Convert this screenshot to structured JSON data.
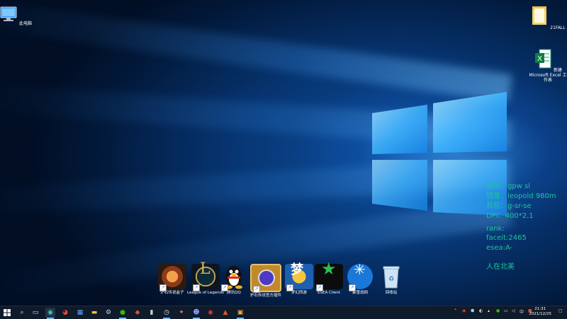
{
  "desktop_icons": {
    "this_pc": "此电脑",
    "folder": "21FALL",
    "excel": "新建 Microsoft Excel 工作表"
  },
  "overlay": {
    "line1": "鼠标：gpw sl",
    "line2": "键盘：leopold 980m",
    "line3": "耳机：g-sr-se",
    "line4": "DPI：400*2.1",
    "line5": "rank:",
    "line6": "faceit:2465",
    "line7": "esea:A-",
    "line8": "人在北美"
  },
  "dock": [
    {
      "label": "炉石传说盒子",
      "icon": "hearthstone-box-icon"
    },
    {
      "label": "League of Legends",
      "icon": "league-of-legends-icon"
    },
    {
      "label": "腾讯QQ",
      "icon": "qq-penguin-icon"
    },
    {
      "label": "炉石传说官方插件",
      "icon": "hearthstone-plugin-icon"
    },
    {
      "label": "梦幻西游",
      "icon": "mhxy-icon"
    },
    {
      "label": "ESEA Client",
      "icon": "esea-icon"
    },
    {
      "label": "暴雪战网",
      "icon": "battlenet-icon"
    },
    {
      "label": "回收站",
      "icon": "recycle-bin-icon"
    }
  ],
  "taskbar": {
    "clock_time": "21:31",
    "clock_date": "2021/12/25"
  },
  "colors": {
    "overlay_text": "#19c79a",
    "taskbar_bg": "#0f1a2a"
  }
}
